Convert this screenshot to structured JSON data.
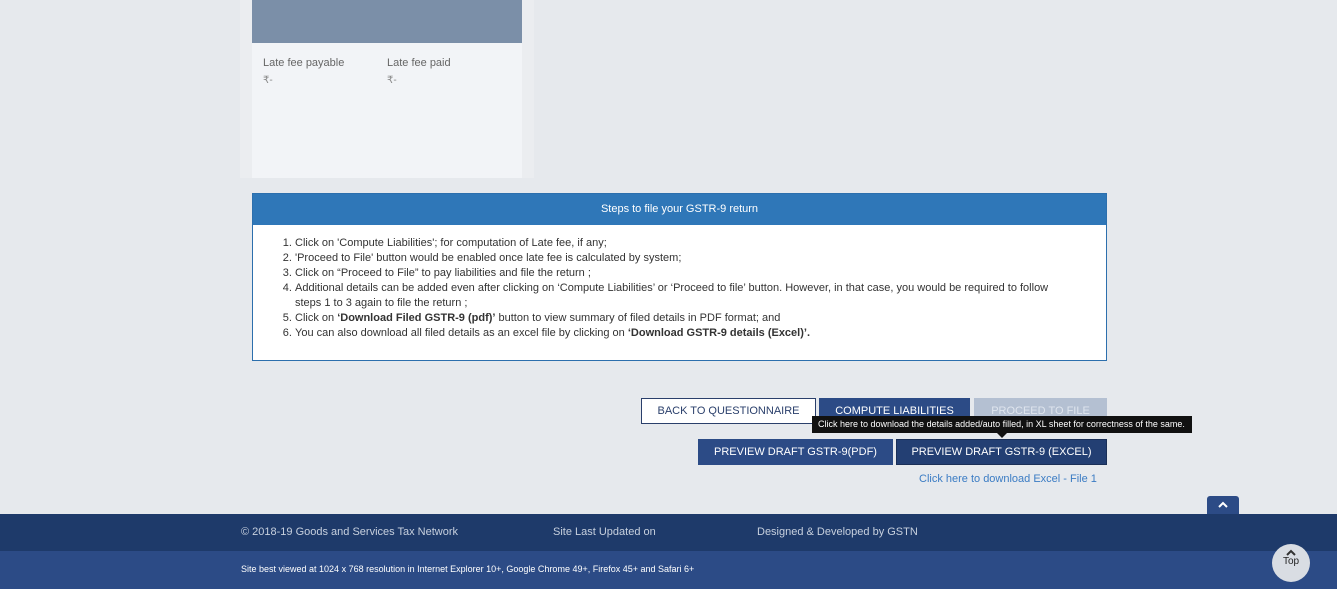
{
  "late_fee": {
    "payable_label": "Late fee payable",
    "payable_value": "₹-",
    "paid_label": "Late fee paid",
    "paid_value": "₹-"
  },
  "steps": {
    "title": "Steps to file your GSTR-9 return",
    "items": [
      {
        "text": "Click on 'Compute Liabilities'; for computation of Late fee, if any;"
      },
      {
        "text": "'Proceed to File' button would be enabled once late fee is calculated by system;"
      },
      {
        "text": "Click on “Proceed to File” to pay liabilities and file the return ;"
      },
      {
        "text": "Additional details can be added even after clicking on ‘Compute Liabilities’ or ‘Proceed to file’ button. However, in that case, you would be required to follow steps 1 to 3 again to file the return ;"
      },
      {
        "pre": "Click on ",
        "bold": "‘Download Filed GSTR-9 (pdf)’",
        "post": " button to view summary of filed details in PDF format; and"
      },
      {
        "pre": "You can also download all filed details as an excel file by clicking on ",
        "bold": "‘Download GSTR-9 details (Excel)’.",
        "post": ""
      }
    ]
  },
  "buttons": {
    "back": "BACK TO QUESTIONNAIRE",
    "compute": "COMPUTE LIABILITIES",
    "proceed": "PROCEED TO FILE",
    "preview_pdf": "PREVIEW DRAFT GSTR-9(PDF)",
    "preview_excel": "PREVIEW DRAFT GSTR-9 (EXCEL)"
  },
  "tooltip": "Click here to download the details added/auto filled, in XL sheet for correctness of the same.",
  "download_link": "Click here to download Excel - File 1",
  "footer": {
    "copyright": "© 2018-19 Goods and Services Tax Network",
    "last_updated": "Site Last Updated on",
    "designed": "Designed & Developed by GSTN",
    "best_viewed": "Site best viewed at 1024 x 768 resolution in Internet Explorer 10+, Google Chrome 49+, Firefox 45+ and Safari 6+"
  },
  "top_button": "Top"
}
